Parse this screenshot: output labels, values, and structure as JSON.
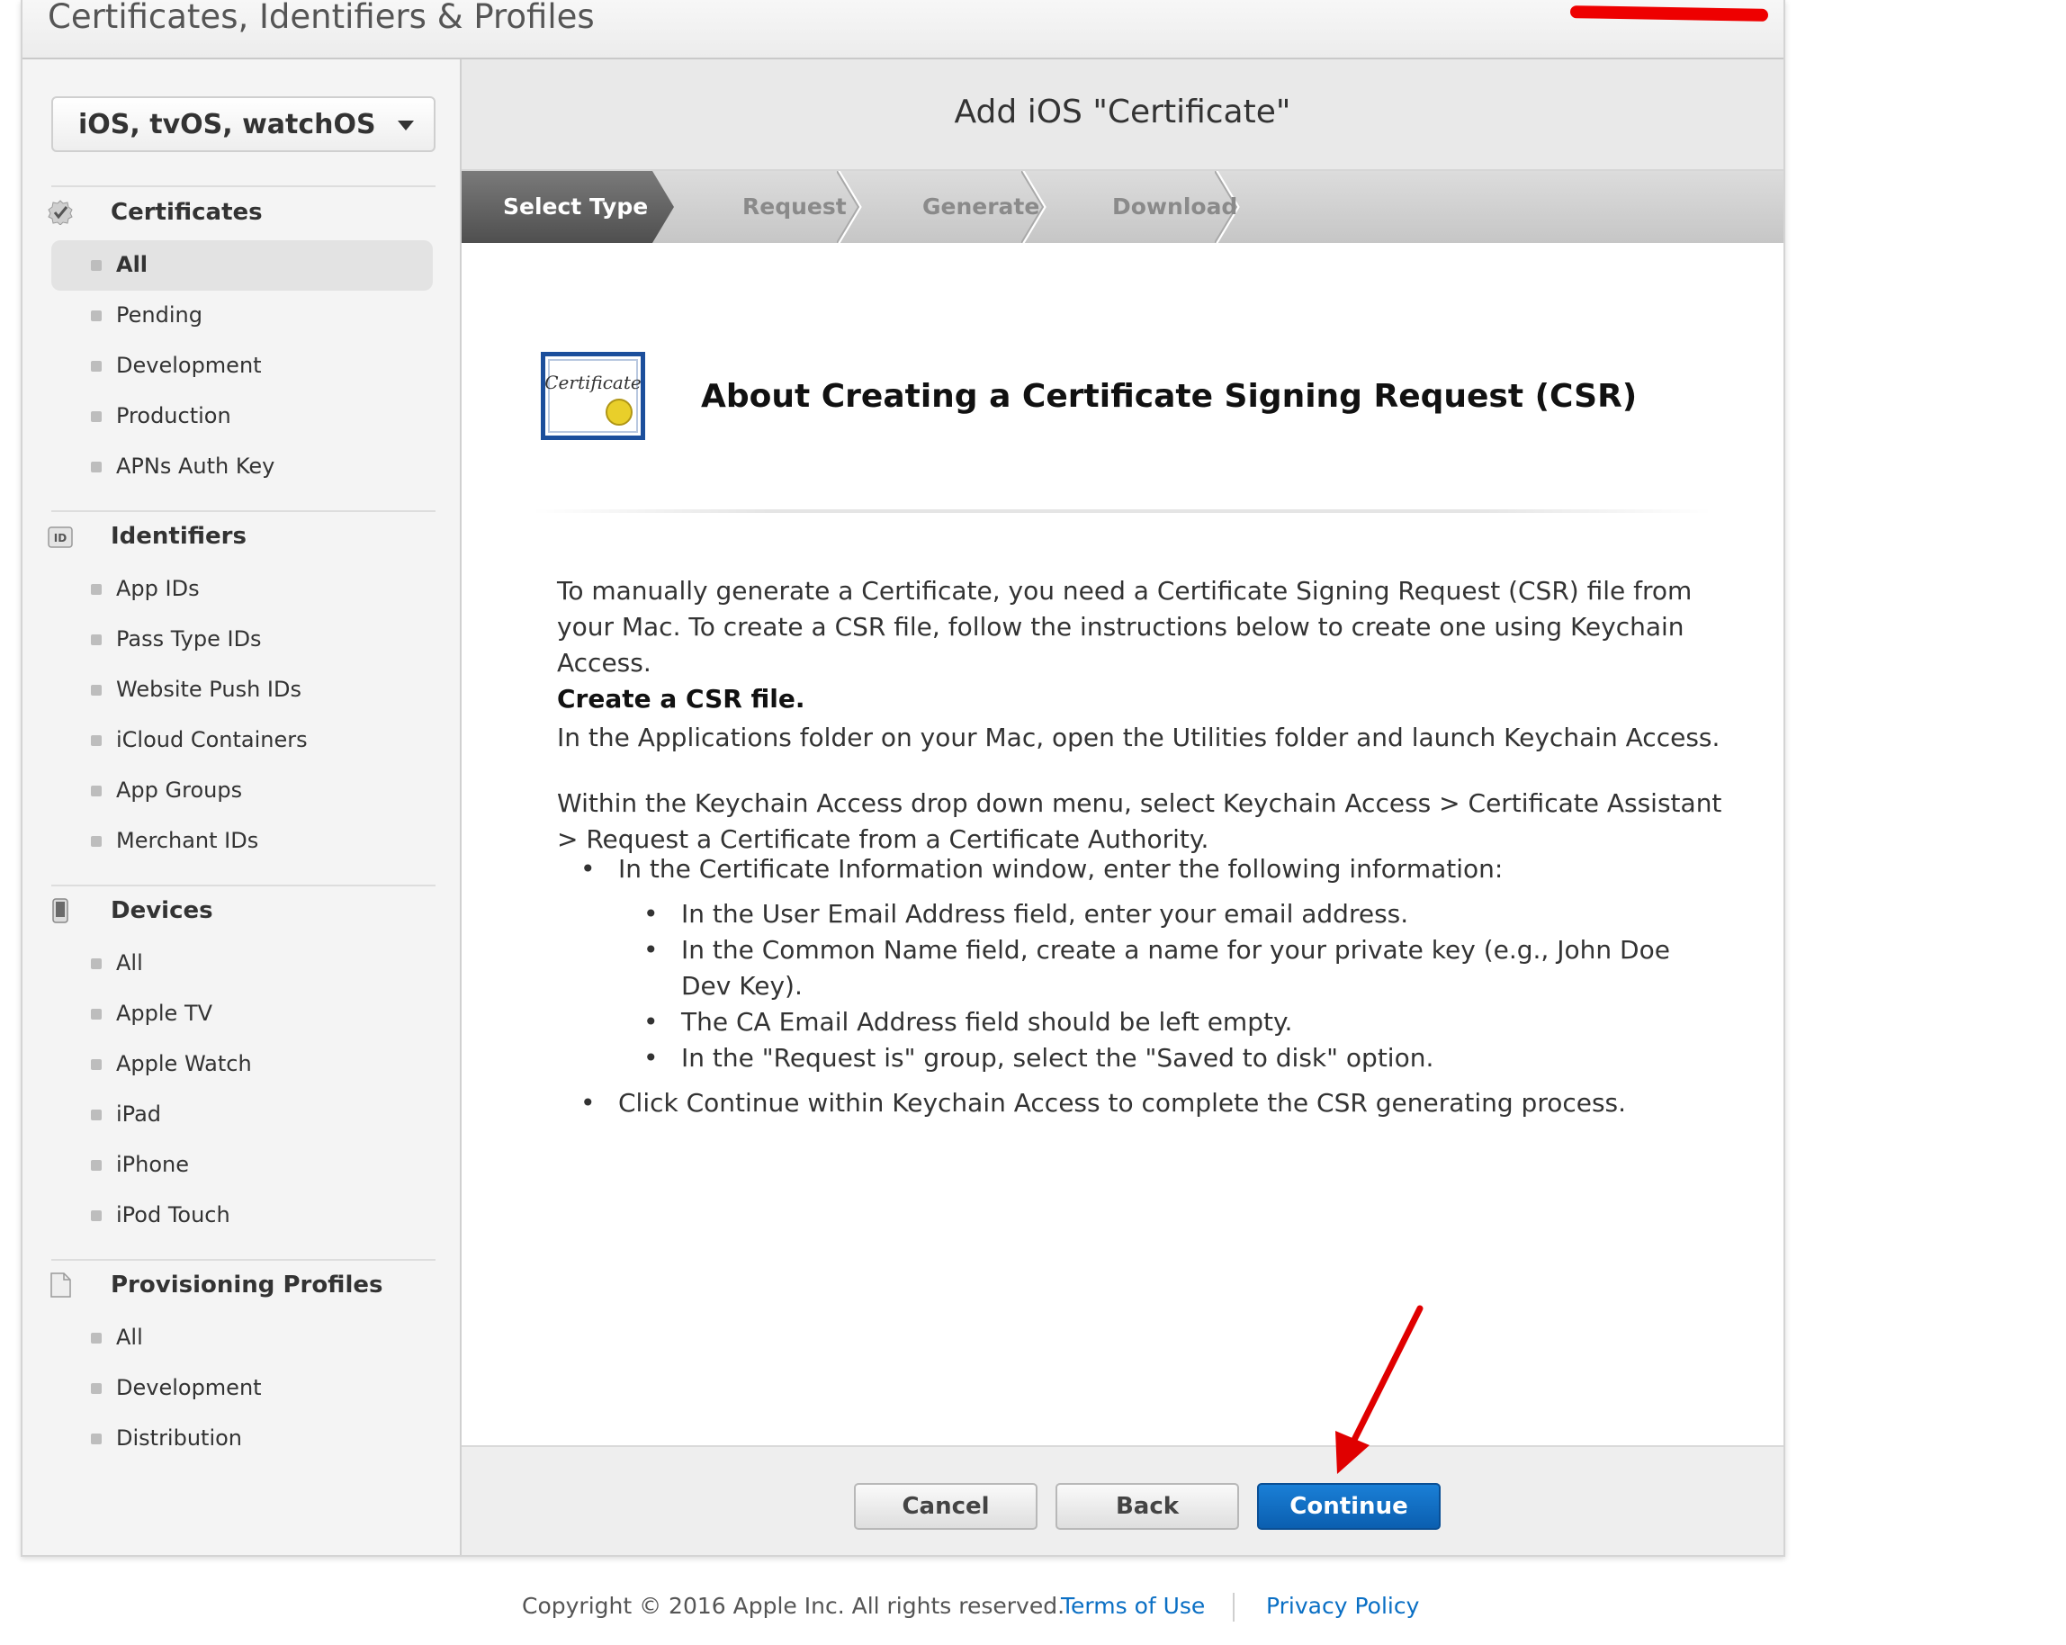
{
  "header": {
    "title": "Certificates, Identifiers & Profiles"
  },
  "sidebar": {
    "platform": "iOS, tvOS, watchOS",
    "sections": [
      {
        "title": "Certificates",
        "icon": "certificate-check-icon",
        "items": [
          "All",
          "Pending",
          "Development",
          "Production",
          "APNs Auth Key"
        ]
      },
      {
        "title": "Identifiers",
        "icon": "id-badge-icon",
        "items": [
          "App IDs",
          "Pass Type IDs",
          "Website Push IDs",
          "iCloud Containers",
          "App Groups",
          "Merchant IDs"
        ]
      },
      {
        "title": "Devices",
        "icon": "device-icon",
        "items": [
          "All",
          "Apple TV",
          "Apple Watch",
          "iPad",
          "iPhone",
          "iPod Touch"
        ]
      },
      {
        "title": "Provisioning Profiles",
        "icon": "document-icon",
        "items": [
          "All",
          "Development",
          "Distribution"
        ]
      }
    ],
    "active": "Certificates/All"
  },
  "main": {
    "title": "Add iOS \"Certificate\"",
    "steps": [
      "Select Type",
      "Request",
      "Generate",
      "Download"
    ],
    "current_step": "Select Type",
    "cert_icon_text": "Certificate",
    "section_title": "About Creating a Certificate Signing Request (CSR)",
    "intro": "To manually generate a Certificate, you need a Certificate Signing Request (CSR) file from your Mac. To create a CSR file, follow the instructions below to create one using Keychain Access.",
    "create_heading": "Create a CSR file.",
    "create_text": "In the Applications folder on your Mac, open the Utilities folder and launch Keychain Access.",
    "menu_text": "Within the Keychain Access drop down menu, select Keychain Access > Certificate Assistant > Request a Certificate from a Certificate Authority.",
    "bullet1": "In the Certificate Information window, enter the following information:",
    "sub_bullets": [
      "In the User Email Address field, enter your email address.",
      "In the Common Name field, create a name for your private key (e.g., John Doe Dev Key).",
      "The CA Email Address field should be left empty.",
      "In the \"Request is\" group, select the \"Saved to disk\" option."
    ],
    "bullet2": "Click Continue within Keychain Access to complete the CSR generating process.",
    "buttons": {
      "cancel": "Cancel",
      "back": "Back",
      "continue": "Continue"
    }
  },
  "footer": {
    "copyright": "Copyright © 2016 Apple Inc. All rights reserved.",
    "terms": "Terms of Use",
    "privacy": "Privacy Policy"
  },
  "colors": {
    "primary_button": "#0b5fb0",
    "link": "#0a6fc4",
    "annotation_arrow": "#e00000"
  }
}
